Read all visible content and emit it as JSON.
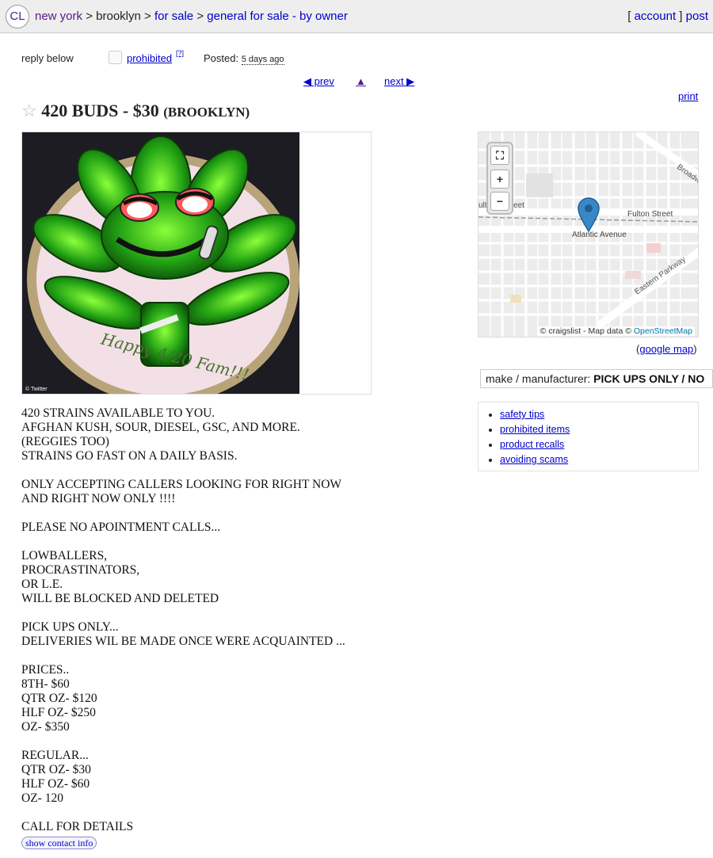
{
  "header": {
    "logo": "CL",
    "breadcrumbs": [
      "new york",
      "brooklyn",
      "for sale",
      "general for sale - by owner"
    ],
    "separator": ">",
    "account": "account",
    "post": "post"
  },
  "actions": {
    "reply": "reply below",
    "prohibited": "prohibited",
    "help": "[?]",
    "posted_label": "Posted:",
    "posted_time": "5 days ago"
  },
  "nav": {
    "prev": "◀ prev",
    "up": "▲",
    "next": "next ▶",
    "print": "print"
  },
  "posting": {
    "star": "☆",
    "title": "420 BUDS - $30",
    "location": "(BROOKLYN)",
    "image_caption": "Happy 4/20 Fam!!!",
    "image_credit": "© Twitter",
    "body": [
      "420 STRAINS AVAILABLE TO YOU.",
      "AFGHAN KUSH, SOUR, DIESEL, GSC, AND MORE.",
      "(REGGIES TOO)",
      "STRAINS GO FAST ON A DAILY BASIS.",
      "",
      "ONLY ACCEPTING CALLERS LOOKING FOR RIGHT NOW",
      "AND RIGHT NOW ONLY !!!!",
      "",
      "PLEASE NO APOINTMENT CALLS...",
      "",
      "LOWBALLERS,",
      "PROCRASTINATORS,",
      "OR L.E.",
      "WILL BE BLOCKED AND DELETED",
      "",
      "PICK UPS ONLY...",
      "DELIVERIES WIL BE MADE ONCE WERE ACQUAINTED ...",
      "",
      "PRICES..",
      "8TH- $60",
      "QTR OZ- $120",
      "HLF OZ- $250",
      "OZ- $350",
      "",
      "REGULAR...",
      "QTR OZ- $30",
      "HLF OZ- $60",
      "OZ- 120",
      "",
      "CALL FOR DETAILS"
    ],
    "contact_button": "show contact info"
  },
  "map": {
    "zoom_in": "+",
    "zoom_out": "−",
    "fullscreen": "⛶",
    "streets": [
      "Fulton Street",
      "Atlantic Avenue",
      "Eastern Parkway",
      "Broadw",
      "ulto",
      "eet"
    ],
    "attribution_prefix": "© craigslist - Map data ©",
    "attribution_link": "OpenStreetMap",
    "google_map": "google map",
    "marker_color": "#3a87c8"
  },
  "attributes": {
    "label": "make / manufacturer:",
    "value": "PICK UPS ONLY / NO"
  },
  "safety_links": [
    "safety tips",
    "prohibited items",
    "product recalls",
    "avoiding scams"
  ]
}
